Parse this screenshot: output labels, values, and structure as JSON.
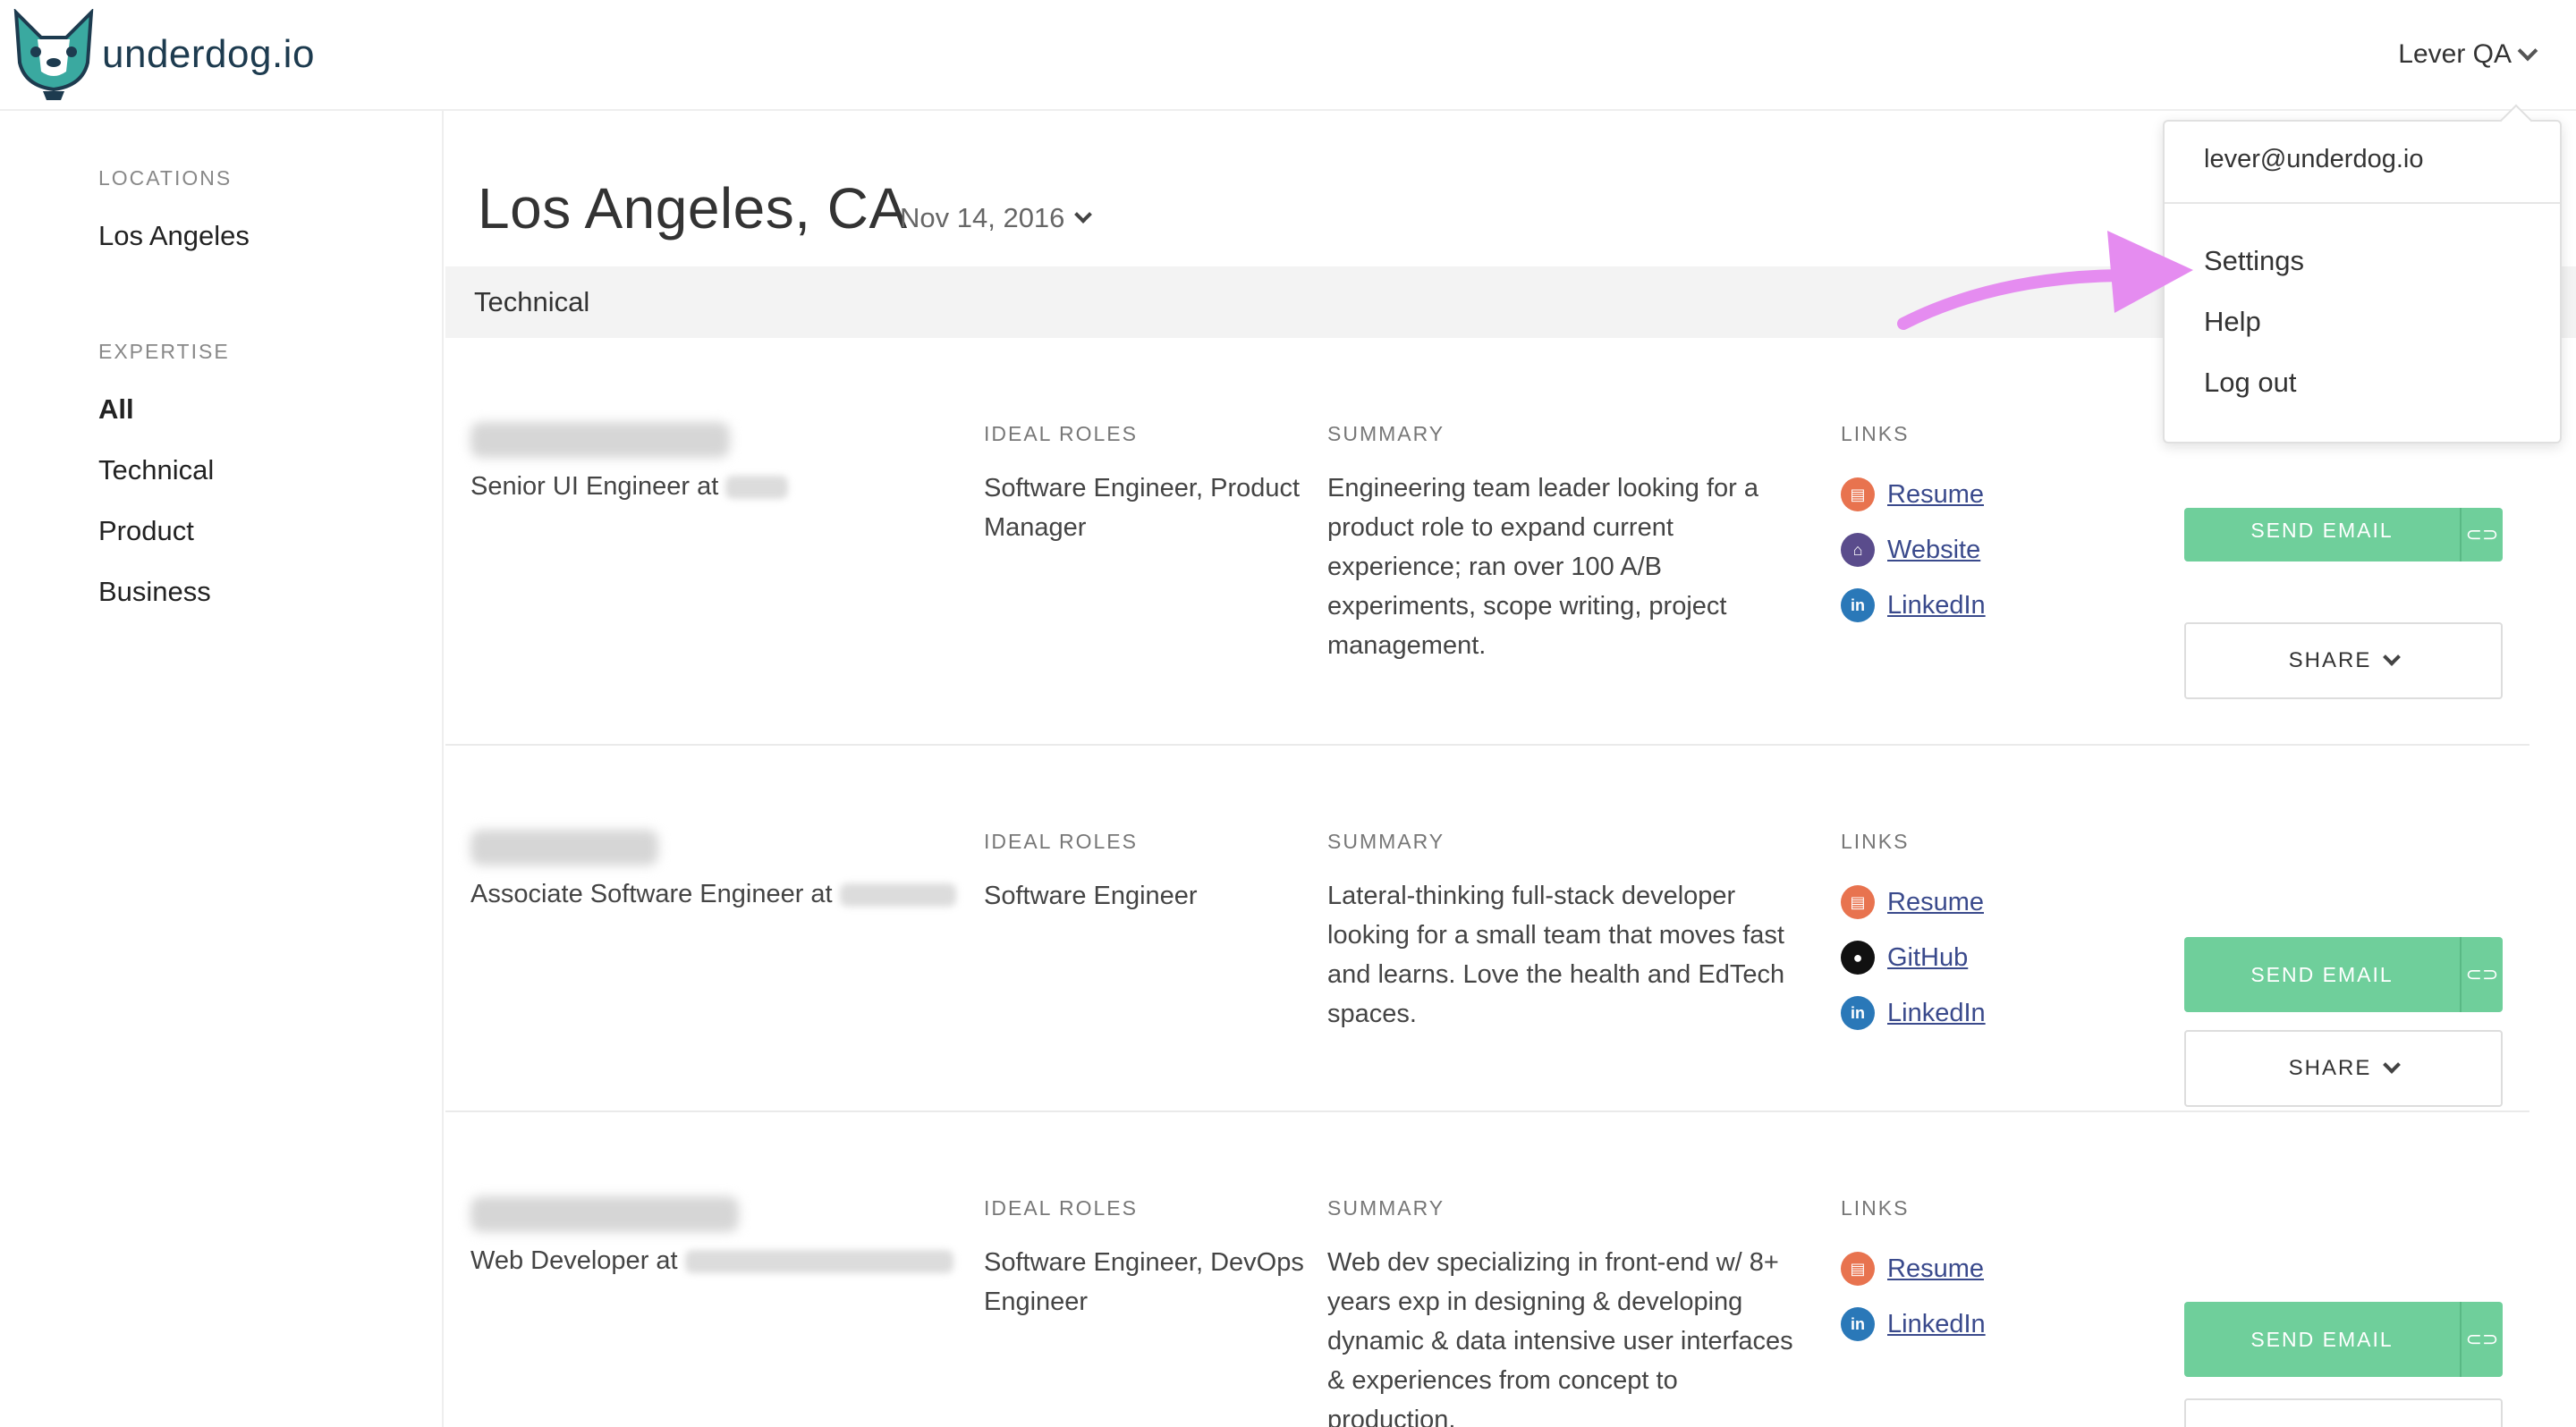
{
  "header": {
    "brand": "underdog.io",
    "account_label": "Lever QA"
  },
  "sidebar": {
    "locations_heading": "LOCATIONS",
    "locations": [
      "Los Angeles"
    ],
    "expertise_heading": "EXPERTISE",
    "expertise": [
      "All",
      "Technical",
      "Product",
      "Business"
    ]
  },
  "main": {
    "title": "Los Angeles, CA",
    "date": "Nov 14, 2016",
    "section": "Technical",
    "labels": {
      "ideal_roles": "IDEAL ROLES",
      "summary": "SUMMARY",
      "links": "LINKS"
    },
    "buttons": {
      "send_email": "SEND EMAIL",
      "share": "SHARE"
    },
    "candidates": [
      {
        "title_prefix": "Senior UI Engineer at",
        "ideal_roles": "Software Engineer, Product Manager",
        "summary": "Engineering team leader looking for a product role to expand current experience; ran over 100 A/B experiments, scope writing, project management.",
        "links": [
          "Resume",
          "Website",
          "LinkedIn"
        ]
      },
      {
        "title_prefix": "Associate Software Engineer at",
        "ideal_roles": "Software Engineer",
        "summary": "Lateral-thinking full-stack developer looking for a small team that moves fast and learns. Love the health and EdTech spaces.",
        "links": [
          "Resume",
          "GitHub",
          "LinkedIn"
        ]
      },
      {
        "title_prefix": "Web Developer at",
        "ideal_roles": "Software Engineer, DevOps Engineer",
        "summary": "Web dev specializing in front-end w/ 8+ years exp in designing & developing dynamic & data intensive user interfaces & experiences from concept to production.",
        "links": [
          "Resume",
          "LinkedIn"
        ]
      }
    ]
  },
  "dropdown": {
    "email": "lever@underdog.io",
    "items": [
      "Settings",
      "Help",
      "Log out"
    ]
  },
  "colors": {
    "accent_green": "#6fcf9b",
    "link_blue": "#3a4a8c",
    "annotation_arrow": "#e58cf0",
    "brand_teal": "#3aa9a0"
  },
  "icons": {
    "resume": "document-icon",
    "website": "home-icon",
    "linkedin": "linkedin-icon",
    "github": "github-icon",
    "share_link": "link-icon"
  }
}
